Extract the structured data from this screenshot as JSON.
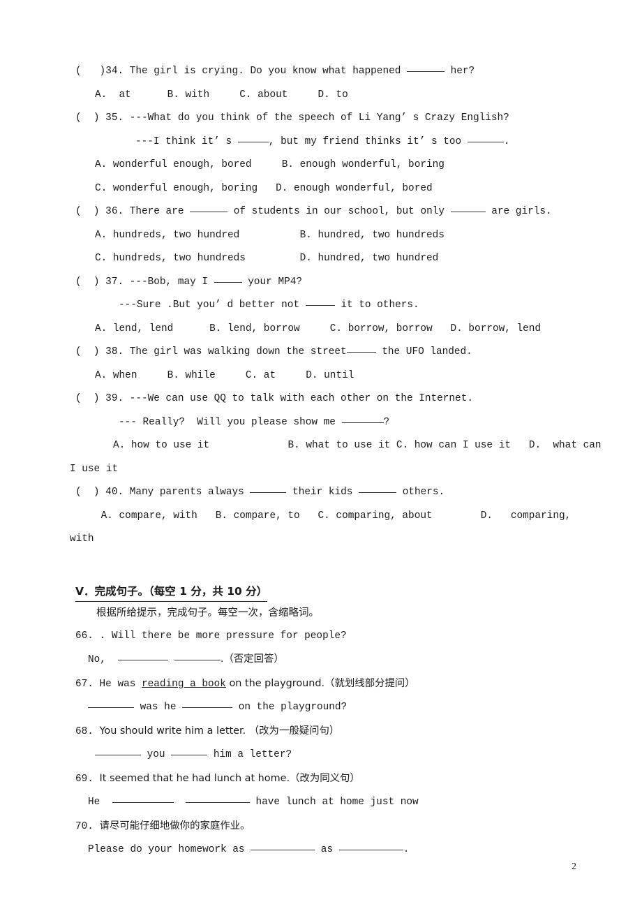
{
  "document": {
    "page_number": "2",
    "ink_color": "#1a1a1a"
  },
  "multiple_choice": {
    "questions": [
      {
        "bracket": "(   )",
        "number": "34.",
        "stem_before": " The girl is crying. Do you know what happened ",
        "stem_after": " her?",
        "options_lines": [
          "A.  at      B. with     C. about     D. to"
        ]
      },
      {
        "bracket": "(  )",
        "number": " 35.",
        "stem_before": " ---What do you think of the speech of Li Yang’ s Crazy English?",
        "stem_after": "",
        "sub_line_a": "---I think it’ s ",
        "sub_line_b": ", but my friend thinks it’ s too ",
        "sub_line_c": ".",
        "options_lines": [
          "A. wonderful enough, bored     B. enough wonderful, boring",
          "C. wonderful enough, boring   D. enough wonderful, bored"
        ]
      },
      {
        "bracket": "(  )",
        "number": " 36.",
        "stem_before": " There are ",
        "stem_mid": " of students in our school, but only ",
        "stem_after": " are girls.",
        "options_lines": [
          "A. hundreds, two hundred          B. hundred, two hundreds",
          "C. hundreds, two hundreds         D. hundred, two hundred"
        ]
      },
      {
        "bracket": "(  )",
        "number": " 37.",
        "stem_before": " ---Bob, may I ",
        "stem_after": " your MP4?",
        "sub_line_a": "---Sure .But you’ d better not ",
        "sub_line_b": " it to others.",
        "options_lines": [
          "A. lend, lend      B. lend, borrow     C. borrow, borrow   D. borrow, lend"
        ]
      },
      {
        "bracket": "(  )",
        "number": " 38.",
        "stem_before": " The girl was walking down the street",
        "stem_after": " the UFO landed.",
        "options_lines": [
          "A. when     B. while     C. at     D. until"
        ]
      },
      {
        "bracket": "(  )",
        "number": " 39.",
        "stem_before": " ---We can use QQ to talk with each other on the Internet.",
        "stem_after": "",
        "sub_line_a": "--- Really?  Will you please show me ",
        "sub_line_b": "?",
        "options_lines": [
          "A. how to use it             B. what to use it C. how can I use it   D.  what can",
          "I use it"
        ]
      },
      {
        "bracket": "(  )",
        "number": " 40.",
        "stem_before": " Many parents always ",
        "stem_mid": " their kids ",
        "stem_after": " others.",
        "options_lines": [
          " A. compare, with   B. compare, to   C. comparing, about        D.   comparing,",
          "with"
        ]
      }
    ]
  },
  "section_v": {
    "heading": "Ⅴ．完成句子。（每空 1 分，共 10 分）",
    "instruction": "根据所给提示，完成句子。每空一次，含缩略词。",
    "items": [
      {
        "number": "66. ",
        "stem": ". Will there be more pressure for people?",
        "answer_prefix": "No,  ",
        "answer_middle": " ",
        "answer_suffix": ".（否定回答）"
      },
      {
        "number": "67. ",
        "stem_before": "He was ",
        "stem_underlined": "reading a book",
        "stem_after": " on the playground.（就划线部分提问）",
        "answer_prefix": "",
        "answer_middle": " was he ",
        "answer_suffix": " on the playground?"
      },
      {
        "number": "68. ",
        "stem": "You should write him a letter. （改为一般疑问句）",
        "answer_prefix": "",
        "answer_middle": " you ",
        "answer_suffix": " him a letter?"
      },
      {
        "number": "69. ",
        "stem": "It seemed that he had lunch at home.（改为同义句）",
        "answer_prefix": "He  ",
        "answer_middle": "  ",
        "answer_suffix": " have lunch at home just now"
      },
      {
        "number": "70. ",
        "stem": "请尽可能仔细地做你的家庭作业。",
        "answer_prefix": "Please do your homework as ",
        "answer_middle": " as ",
        "answer_suffix": "."
      }
    ]
  }
}
